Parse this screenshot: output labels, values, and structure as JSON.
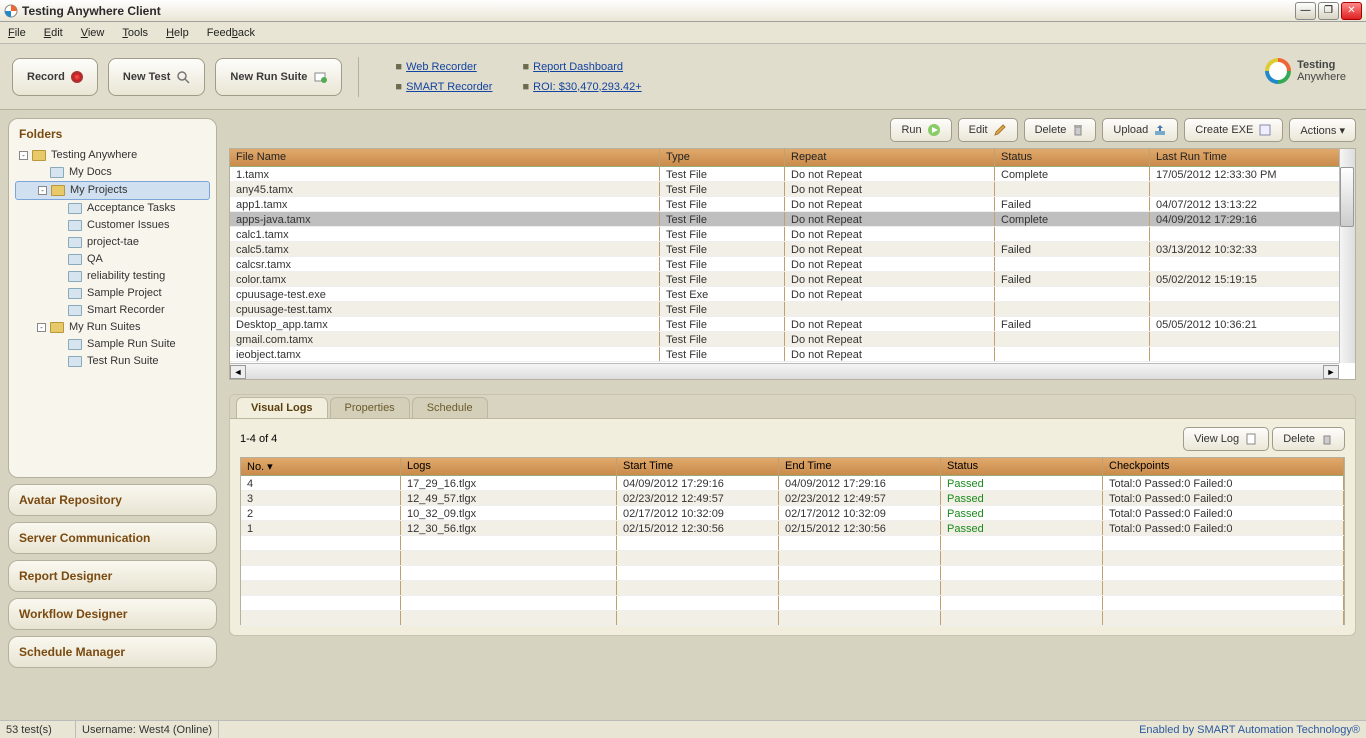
{
  "window": {
    "title": "Testing Anywhere Client"
  },
  "menu": {
    "file": "File",
    "edit": "Edit",
    "view": "View",
    "tools": "Tools",
    "help": "Help",
    "feedback": "Feedback"
  },
  "toolbar": {
    "record": "Record",
    "newtest": "New Test",
    "newrun": "New Run Suite",
    "links": {
      "web": "Web Recorder",
      "smart": "SMART Recorder",
      "report": "Report Dashboard",
      "roi": "ROI: $30,470,293.42+"
    }
  },
  "brand": {
    "l1": "Testing",
    "l2": "Anywhere"
  },
  "sidebar": {
    "title": "Folders",
    "tree": [
      {
        "lvl": 1,
        "exp": "-",
        "label": "Testing Anywhere"
      },
      {
        "lvl": 2,
        "doc": true,
        "label": "My Docs"
      },
      {
        "lvl": 2,
        "exp": "-",
        "label": "My Projects",
        "selected": true
      },
      {
        "lvl": 3,
        "doc": true,
        "label": "Acceptance Tasks"
      },
      {
        "lvl": 3,
        "doc": true,
        "label": "Customer Issues"
      },
      {
        "lvl": 3,
        "doc": true,
        "label": "project-tae"
      },
      {
        "lvl": 3,
        "doc": true,
        "label": "QA"
      },
      {
        "lvl": 3,
        "doc": true,
        "label": "reliability testing"
      },
      {
        "lvl": 3,
        "doc": true,
        "label": "Sample Project"
      },
      {
        "lvl": 3,
        "doc": true,
        "label": "Smart Recorder"
      },
      {
        "lvl": 2,
        "exp": "-",
        "label": "My Run Suites"
      },
      {
        "lvl": 3,
        "doc": true,
        "label": "Sample Run Suite"
      },
      {
        "lvl": 3,
        "doc": true,
        "label": "Test Run Suite"
      }
    ],
    "nav": [
      "Avatar Repository",
      "Server Communication",
      "Report Designer",
      "Workflow Designer",
      "Schedule Manager"
    ]
  },
  "actions": {
    "run": "Run",
    "edit": "Edit",
    "delete": "Delete",
    "upload": "Upload",
    "createexe": "Create EXE",
    "actionsbtn": "Actions  ▾"
  },
  "table": {
    "headers": {
      "fn": "File Name",
      "ty": "Type",
      "rp": "Repeat",
      "st": "Status",
      "lr": "Last Run Time"
    },
    "rows": [
      {
        "fn": "1.tamx",
        "ty": "Test File",
        "rp": "Do not Repeat",
        "st": "Complete",
        "lr": "17/05/2012 12:33:30 PM"
      },
      {
        "fn": "any45.tamx",
        "ty": "Test File",
        "rp": "Do not Repeat",
        "st": "",
        "lr": ""
      },
      {
        "fn": "app1.tamx",
        "ty": "Test File",
        "rp": "Do not Repeat",
        "st": "Failed",
        "lr": "04/07/2012 13:13:22"
      },
      {
        "fn": "apps-java.tamx",
        "ty": "Test File",
        "rp": "Do not Repeat",
        "st": "Complete",
        "lr": "04/09/2012 17:29:16",
        "sel": true
      },
      {
        "fn": "calc1.tamx",
        "ty": "Test File",
        "rp": "Do not Repeat",
        "st": "",
        "lr": ""
      },
      {
        "fn": "calc5.tamx",
        "ty": "Test File",
        "rp": "Do not Repeat",
        "st": "Failed",
        "lr": "03/13/2012 10:32:33"
      },
      {
        "fn": "calcsr.tamx",
        "ty": "Test File",
        "rp": "Do not Repeat",
        "st": "",
        "lr": ""
      },
      {
        "fn": "color.tamx",
        "ty": "Test File",
        "rp": "Do not Repeat",
        "st": "Failed",
        "lr": "05/02/2012 15:19:15"
      },
      {
        "fn": "cpuusage-test.exe",
        "ty": "Test Exe",
        "rp": "Do not Repeat",
        "st": "",
        "lr": ""
      },
      {
        "fn": "cpuusage-test.tamx",
        "ty": "Test File",
        "rp": "",
        "st": "",
        "lr": ""
      },
      {
        "fn": "Desktop_app.tamx",
        "ty": "Test File",
        "rp": "Do not Repeat",
        "st": "Failed",
        "lr": "05/05/2012 10:36:21"
      },
      {
        "fn": "gmail.com.tamx",
        "ty": "Test File",
        "rp": "Do not Repeat",
        "st": "",
        "lr": ""
      },
      {
        "fn": "ieobject.tamx",
        "ty": "Test File",
        "rp": "Do not Repeat",
        "st": "",
        "lr": ""
      }
    ]
  },
  "tabs": {
    "visual": "Visual Logs",
    "props": "Properties",
    "sched": "Schedule"
  },
  "logs": {
    "count": "1-4 of 4",
    "viewlog": "View Log",
    "delete": "Delete",
    "headers": {
      "no": "No.   ▾",
      "log": "Logs",
      "st": "Start Time",
      "et": "End Time",
      "stt": "Status",
      "cp": "Checkpoints"
    },
    "rows": [
      {
        "no": "4",
        "log": "17_29_16.tlgx",
        "st": "04/09/2012 17:29:16",
        "et": "04/09/2012 17:29:16",
        "stt": "Passed",
        "cp": "Total:0 Passed:0 Failed:0"
      },
      {
        "no": "3",
        "log": "12_49_57.tlgx",
        "st": "02/23/2012 12:49:57",
        "et": "02/23/2012 12:49:57",
        "stt": "Passed",
        "cp": "Total:0 Passed:0 Failed:0"
      },
      {
        "no": "2",
        "log": "10_32_09.tlgx",
        "st": "02/17/2012 10:32:09",
        "et": "02/17/2012 10:32:09",
        "stt": "Passed",
        "cp": "Total:0 Passed:0 Failed:0"
      },
      {
        "no": "1",
        "log": "12_30_56.tlgx",
        "st": "02/15/2012 12:30:56",
        "et": "02/15/2012 12:30:56",
        "stt": "Passed",
        "cp": "Total:0 Passed:0 Failed:0"
      }
    ]
  },
  "status": {
    "tests": "53 test(s)",
    "user": "Username: West4 (Online)",
    "right": "Enabled by SMART Automation Technology®"
  }
}
